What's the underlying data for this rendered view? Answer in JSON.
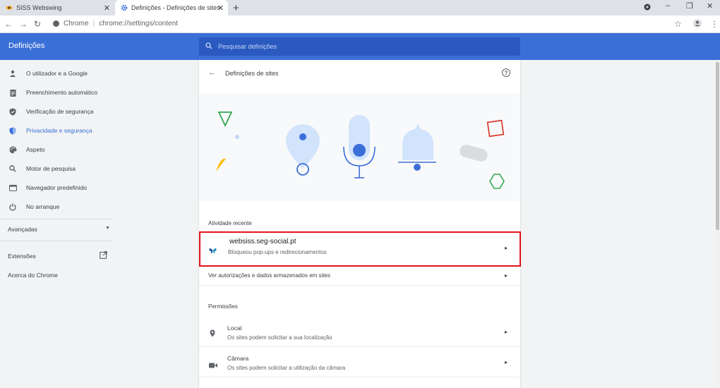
{
  "tabs": [
    {
      "title": "SISS Webswing",
      "favicon": "eye-favicon"
    },
    {
      "title": "Definições - Definições de sites",
      "favicon": "gear-favicon"
    }
  ],
  "new_tab_symbol": "+",
  "window_controls": {
    "minimize": "–",
    "restore": "❐",
    "close": "✕"
  },
  "address": {
    "scheme_label": "Chrome",
    "separator": "|",
    "path": "chrome://settings/content"
  },
  "header": {
    "title": "Definições",
    "search_placeholder": "Pesquisar definições"
  },
  "sidebar": {
    "items": [
      {
        "label": "O utilizador e a Google",
        "icon": "person-icon",
        "active": false
      },
      {
        "label": "Preenchimento automático",
        "icon": "clipboard-icon",
        "active": false
      },
      {
        "label": "Verificação de segurança",
        "icon": "shield-check-icon",
        "active": false
      },
      {
        "label": "Privacidade e segurança",
        "icon": "shield-privacy-icon",
        "active": true
      },
      {
        "label": "Aspeto",
        "icon": "palette-icon",
        "active": false
      },
      {
        "label": "Motor de pesquisa",
        "icon": "search-icon",
        "active": false
      },
      {
        "label": "Navegador predefinido",
        "icon": "browser-icon",
        "active": false
      },
      {
        "label": "No arranque",
        "icon": "power-icon",
        "active": false
      }
    ],
    "advanced": "Avançadas",
    "extensions": "Extensões",
    "about": "Acerca do Chrome"
  },
  "card": {
    "title": "Definições de sites",
    "recent_label": "Atividade recente",
    "recent_site": {
      "name": "websiss.seg-social.pt",
      "detail": "Bloqueou pop-ups e redirecionamentos"
    },
    "view_all": "Ver autorizações e dados armazenados em sites",
    "permissions_label": "Permissões",
    "permissions": [
      {
        "title": "Local",
        "detail": "Os sites podem solicitar a sua localização",
        "icon": "location-pin-icon"
      },
      {
        "title": "Câmara",
        "detail": "Os sites podem solicitar a utilização da câmara",
        "icon": "camera-icon"
      }
    ]
  },
  "colors": {
    "accent": "#3b6fd8",
    "highlight_box": "#e0141e"
  }
}
